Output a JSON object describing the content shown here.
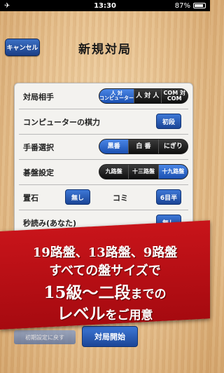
{
  "status_bar": {
    "time": "13:30",
    "battery": "87%"
  },
  "header": {
    "cancel_label": "キャンセル",
    "title": "新規対局"
  },
  "settings": {
    "opponent": {
      "label": "対局相手",
      "options": [
        "人 対\nコンピューター",
        "人 対 人",
        "COM 対\nCOM"
      ],
      "selected_index": 0
    },
    "strength": {
      "label": "コンピューターの棋力",
      "value": "初段"
    },
    "order": {
      "label": "手番選択",
      "options": [
        "黒番",
        "白 番",
        "にぎり"
      ],
      "selected_index": 0
    },
    "board": {
      "label": "碁盤設定",
      "options": [
        "九路盤",
        "十三路盤",
        "十九路盤"
      ],
      "selected_index": 2
    },
    "handicap": {
      "label": "置石",
      "value": "無し"
    },
    "komi": {
      "label": "コミ",
      "value": "6目半"
    },
    "byoyomi": {
      "label": "秒読み(あなた)",
      "value": "無し"
    }
  },
  "footer": {
    "start_label": "対局開始",
    "load_label": "初期設定に戻す"
  },
  "banner": {
    "line1": "19路盤、13路盤、9路盤",
    "line2": "すべての盤サイズで",
    "line3_big": "15級〜二段",
    "line3_small": "までの",
    "line4_big": "レベル",
    "line4_small": "をご用意"
  }
}
